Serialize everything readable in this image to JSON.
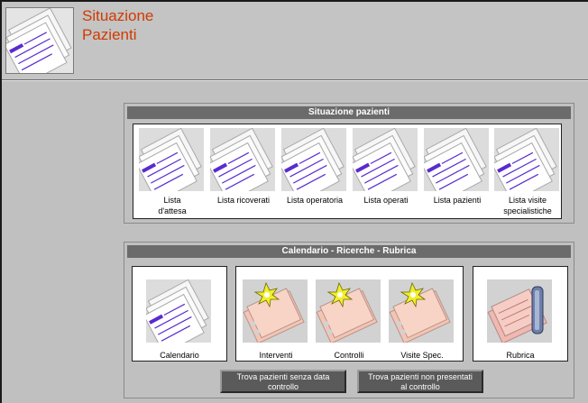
{
  "header": {
    "title_line1": "Situazione",
    "title_line2": "Pazienti",
    "icon": "document-stack-icon"
  },
  "situazione": {
    "title": "Situazione pazienti",
    "tiles": [
      {
        "line1": "Lista",
        "line2": "d'attesa"
      },
      {
        "line1": "Lista ricoverati",
        "line2": ""
      },
      {
        "line1": "Lista operatoria",
        "line2": ""
      },
      {
        "line1": "Lista operati",
        "line2": ""
      },
      {
        "line1": "Lista pazienti",
        "line2": ""
      },
      {
        "line1": "Lista visite",
        "line2": "specialistiche"
      }
    ]
  },
  "calendario": {
    "title": "Calendario - Ricerche - Rubrica",
    "calendar_label": "Calendario",
    "search_tiles": [
      "Interventi",
      "Controlli",
      "Visite Spec."
    ],
    "rubrica_label": "Rubrica",
    "buttons": [
      {
        "line1": "Trova pazienti senza data",
        "line2": "controllo"
      },
      {
        "line1": "Trova pazienti non presentati",
        "line2": "al controllo"
      }
    ]
  },
  "colors": {
    "title_red": "#d13a00",
    "bar_gray": "#6b6b6b",
    "background": "#c0c0c0",
    "icon_purple": "#5a2bd0"
  }
}
